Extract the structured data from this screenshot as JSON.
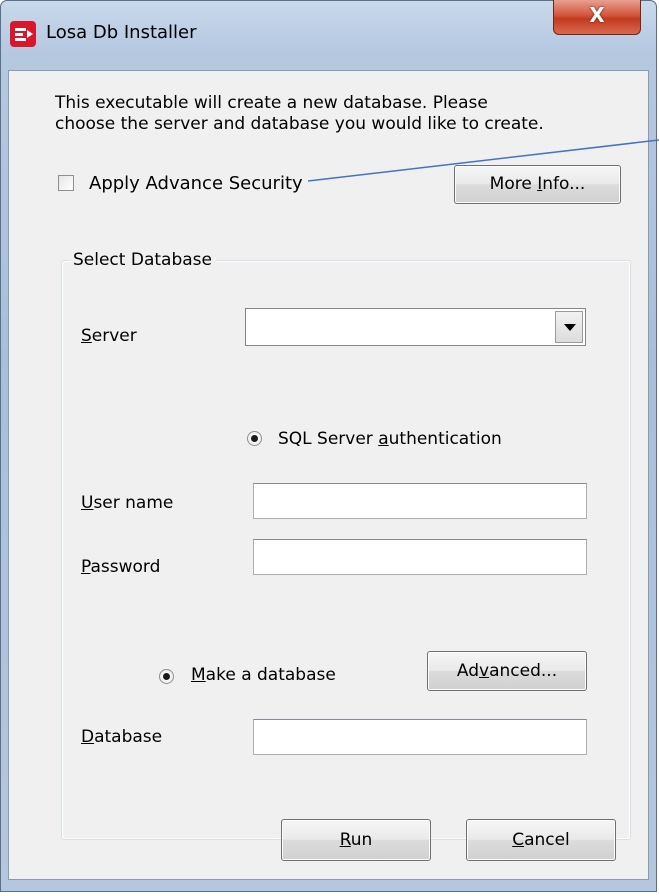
{
  "window": {
    "title": "Losa Db Installer",
    "close_label": "X"
  },
  "intro": {
    "line1": "This executable will create a new database. Please",
    "line2": "choose the server and database you would like to create."
  },
  "security": {
    "checkbox_label": "Apply Advance Security",
    "checked": false,
    "more_info_button": {
      "pre": "More ",
      "mnemonic": "I",
      "post": "nfo..."
    }
  },
  "select_database": {
    "group_label": "Select Database",
    "server_label": {
      "mnemonic": "S",
      "post": "erver"
    },
    "server_value": "",
    "auth_radio": {
      "pre": "SQL Server ",
      "mnemonic": "a",
      "post": "uthentication",
      "selected": true
    },
    "username_label": {
      "mnemonic": "U",
      "post": "ser name"
    },
    "username_value": "",
    "password_label": {
      "mnemonic": "P",
      "post": "assword"
    },
    "password_value": "",
    "make_db_radio": {
      "mnemonic": "M",
      "post": "ake a database",
      "selected": true
    },
    "advanced_button": {
      "pre": "Ad",
      "mnemonic": "v",
      "post": "anced..."
    },
    "database_label": {
      "mnemonic": "D",
      "post": "atabase"
    },
    "database_value": ""
  },
  "footer": {
    "run_button": {
      "mnemonic": "R",
      "post": "un"
    },
    "cancel_button": {
      "mnemonic": "C",
      "post": "ancel"
    }
  },
  "colors": {
    "annotation_line": "#4472c4",
    "close_button": "#c23a20",
    "app_icon": "#d8162c"
  }
}
